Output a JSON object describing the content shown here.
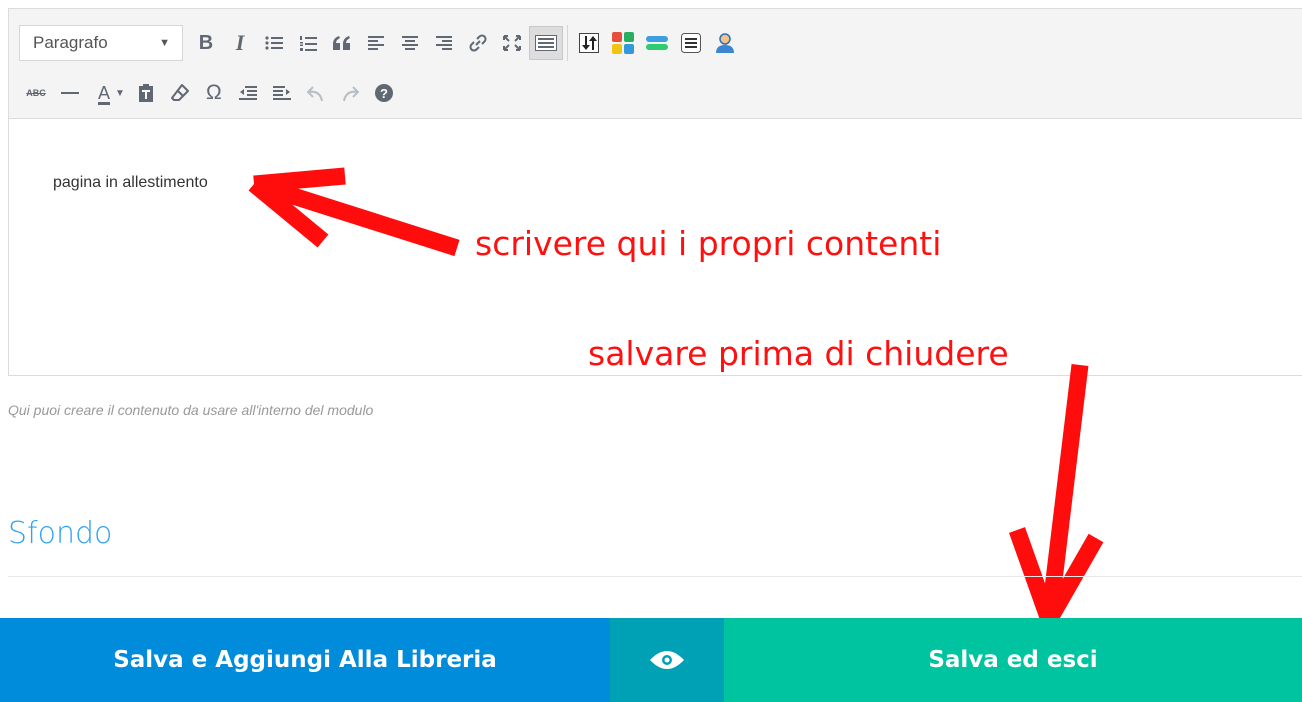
{
  "toolbar": {
    "format_select_value": "Paragrafo",
    "row1_buttons": [
      "bold-icon",
      "italic-icon",
      "bullet-list-icon",
      "numbered-list-icon",
      "blockquote-icon",
      "align-left-icon",
      "align-center-icon",
      "align-right-icon",
      "link-icon",
      "fullscreen-icon",
      "toolbar-toggle-icon",
      "insert-shortcode-icon",
      "columns-shortcode-icon",
      "tabs-shortcode-icon",
      "text-block-shortcode-icon",
      "user-shortcode-icon"
    ],
    "row2_buttons": [
      "strikethrough-icon",
      "horizontal-line-icon",
      "text-color-icon",
      "paste-text-icon",
      "clear-formatting-icon",
      "special-character-icon",
      "outdent-icon",
      "indent-icon",
      "undo-icon",
      "redo-icon",
      "help-icon"
    ],
    "bold_glyph": "B",
    "italic_glyph": "I",
    "strike_glyph": "ABC",
    "color_glyph": "A",
    "omega_glyph": "Ω"
  },
  "editor": {
    "content_text": "pagina in allestimento"
  },
  "annotations": {
    "write_here": "scrivere qui i propri contenti",
    "save_before": "salvare prima di chiudere",
    "color": "#ff1010"
  },
  "help_text": "Qui puoi creare il contenuto da usare all'interno del modulo",
  "section_title": "Sfondo",
  "footer": {
    "save_library_label": "Salva e Aggiungi Alla Libreria",
    "preview_icon": "eye-icon",
    "save_exit_label": "Salva ed esci",
    "colors": {
      "library": "#008bdb",
      "preview": "#00a1b5",
      "save": "#00c3a0"
    }
  }
}
